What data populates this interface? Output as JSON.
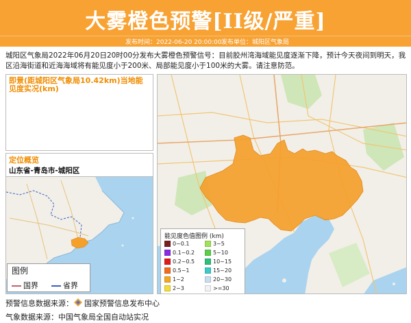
{
  "header": {
    "title": "大雾橙色预警[II级/严重]",
    "publish_time_label": "发布时间：2022-06-20 20:00:00",
    "publish_unit_label": "发布单位：城阳区气象局"
  },
  "description": "城阳区气象局2022年06月20日20时00分发布大雾橙色预警信号：目前胶州湾海域能见度逐渐下降，预计今天夜间到明天，我区沿海街道和近海海域将有能见度小于200米、局部能见度小于100米的大雾。请注意防范。",
  "instant_panel": {
    "title": "即景(距城阳区气象局10.42km)当地能见度实况(km)"
  },
  "location_panel": {
    "title": "定位概览",
    "location": "山东省-青岛市-城阳区"
  },
  "mini_legend": {
    "title": "图例",
    "items": [
      {
        "label": "国界",
        "color": "#c06070"
      },
      {
        "label": "省界",
        "color": "#3a5fbf"
      }
    ]
  },
  "visibility_legend": {
    "title": "能见度色值图例 (km)",
    "items": [
      {
        "label": "0~0.1",
        "color": "#7a1f1f"
      },
      {
        "label": "0.1~0.2",
        "color": "#8a2be2"
      },
      {
        "label": "0.2~0.5",
        "color": "#e01b1b"
      },
      {
        "label": "0.5~1",
        "color": "#f36b1c"
      },
      {
        "label": "1~2",
        "color": "#f6a623"
      },
      {
        "label": "2~3",
        "color": "#f4dc3c"
      },
      {
        "label": "3~5",
        "color": "#a5e05a"
      },
      {
        "label": "5~10",
        "color": "#5ccf4a"
      },
      {
        "label": "10~15",
        "color": "#2fbf7a"
      },
      {
        "label": "15~20",
        "color": "#3fc9c9"
      },
      {
        "label": "20~30",
        "color": "#c9dff0"
      },
      {
        "label": ">=30",
        "color": "#f3f3f3"
      }
    ]
  },
  "sources": {
    "warning_source_prefix": "预警信息数据来源：",
    "warning_source_name": "国家预警信息发布中心",
    "weather_source": "气象数据来源：中国气象局全国自动站实况"
  },
  "colors": {
    "accent": "#f7a233",
    "panel_title": "#f08c00",
    "fog_area": "#f5a02a",
    "sea": "#a9d3ee",
    "land": "#f2efe9"
  }
}
